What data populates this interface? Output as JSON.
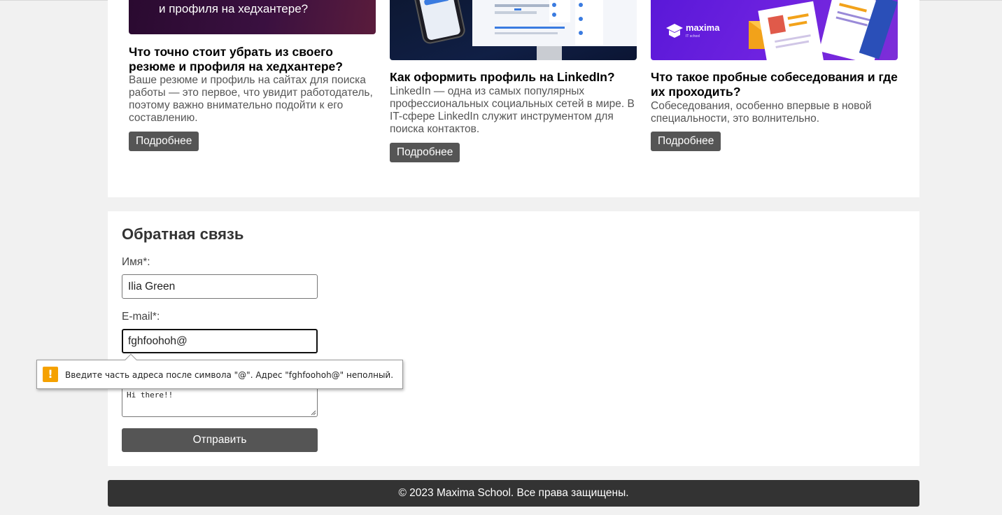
{
  "articles": [
    {
      "image_text": "и профиля на хедхантере?",
      "title": "Что точно стоит убрать из своего резюме и профиля на хедхантере?",
      "description": "Ваше резюме и профиль на сайтах для поиска работы — это первое, что увидит работодатель, поэтому важно внимательно подойти к его составлению.",
      "button": "Подробнее"
    },
    {
      "title": "Как оформить профиль на LinkedIn?",
      "description": "LinkedIn — одна из самых популярных профессиональных социальных сетей в мире. В IT-сфере LinkedIn служит инструментом для поиска контактов.",
      "button": "Подробнее"
    },
    {
      "image_logo": "maxima",
      "image_logo_sub": "IT school",
      "title": "Что такое пробные собеседования и где их проходить?",
      "description": "Собеседования, особенно впервые в новой специальности, это волнительно.",
      "button": "Подробнее"
    }
  ],
  "feedback": {
    "title": "Обратная связь",
    "name_label": "Имя*:",
    "name_value": "Ilia Green",
    "email_label": "E-mail*:",
    "email_value": "fghfoohoh@",
    "message_value": "Hi there!!",
    "submit_label": "Отправить"
  },
  "validation_tooltip": {
    "icon": "warning-icon",
    "message": "Введите часть адреса после символа \"@\". Адрес \"fghfoohoh@\" неполный."
  },
  "footer": {
    "text": "© 2023 Maxima School. Все права защищены."
  },
  "colors": {
    "button": "#555555",
    "footer": "#333333",
    "warning": "#f5a100",
    "page_bg": "#f1f1f1"
  }
}
